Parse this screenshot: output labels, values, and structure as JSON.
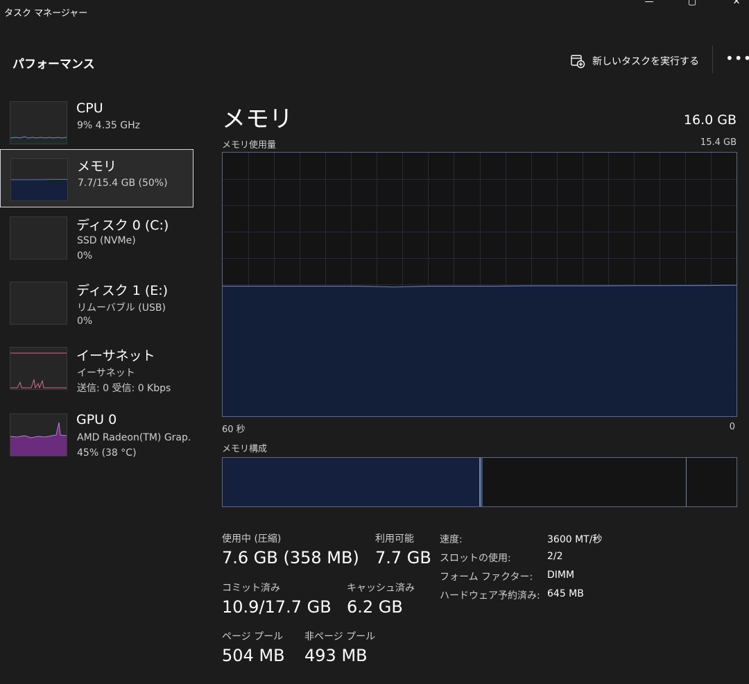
{
  "window": {
    "title": "タスク マネージャー",
    "minimize_glyph": "—",
    "maximize_glyph": "▢",
    "close_glyph": "✕"
  },
  "commandbar": {
    "page_title": "パフォーマンス",
    "new_task_label": "新しいタスクを実行する",
    "more_glyph": "•••"
  },
  "sidebar": {
    "items": [
      {
        "title": "CPU",
        "line1": "9% 4.35 GHz",
        "line2": ""
      },
      {
        "title": "メモリ",
        "line1": "7.7/15.4 GB (50%)",
        "line2": ""
      },
      {
        "title": "ディスク 0 (C:)",
        "line1": "SSD (NVMe)",
        "line2": "0%"
      },
      {
        "title": "ディスク 1 (E:)",
        "line1": "リムーバブル (USB)",
        "line2": "0%"
      },
      {
        "title": "イーサネット",
        "line1": "イーサネット",
        "line2": "送信: 0 受信: 0 Kbps"
      },
      {
        "title": "GPU 0",
        "line1": "AMD Radeon(TM) Grap.",
        "line2": "45% (38 °C)"
      }
    ]
  },
  "main": {
    "title": "メモリ",
    "total": "16.0 GB",
    "usage_label": "メモリ使用量",
    "usage_max": "15.4 GB",
    "axis_left": "60 秒",
    "axis_right": "0",
    "composition_label": "メモリ構成"
  },
  "chart_data": {
    "type": "area",
    "x": [
      60,
      0
    ],
    "y_unit": "GB",
    "ylim": [
      0,
      15.4
    ],
    "values": [
      7.6,
      7.6,
      7.6,
      7.6,
      7.6,
      7.55,
      7.6,
      7.6,
      7.6,
      7.62,
      7.62,
      7.62,
      7.63,
      7.63,
      7.64,
      7.65
    ],
    "grid": true,
    "composition": {
      "in_use_gb": 7.6,
      "available_gb": 7.7
    }
  },
  "stats": {
    "in_use_label": "使用中 (圧縮)",
    "in_use_value": "7.6 GB (358 MB)",
    "available_label": "利用可能",
    "available_value": "7.7 GB",
    "committed_label": "コミット済み",
    "committed_value": "10.9/17.7 GB",
    "cached_label": "キャッシュ済み",
    "cached_value": "6.2 GB",
    "paged_label": "ページ プール",
    "paged_value": "504 MB",
    "nonpaged_label": "非ページ プール",
    "nonpaged_value": "493 MB"
  },
  "specs": [
    {
      "key": "速度:",
      "value": "3600 MT/秒"
    },
    {
      "key": "スロットの使用:",
      "value": "2/2"
    },
    {
      "key": "フォーム ファクター:",
      "value": "DIMM"
    },
    {
      "key": "ハードウェア予約済み:",
      "value": "645 MB"
    }
  ],
  "colors": {
    "memory": "#5d78b8",
    "memory_fill": "#14203d",
    "cpu": "#3fa6c9",
    "ethernet": "#d56b93",
    "gpu": "#9b3fb5"
  }
}
